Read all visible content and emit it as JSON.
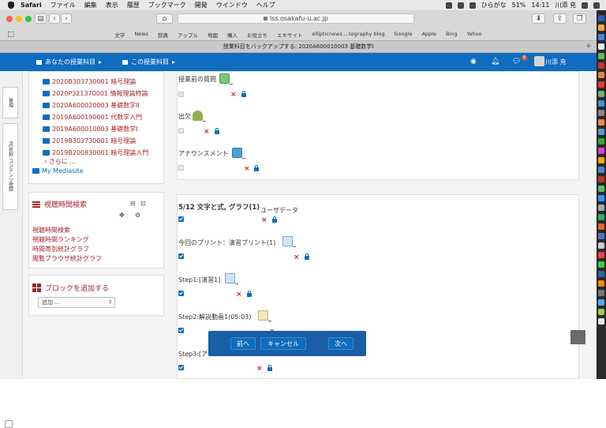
{
  "menubar": {
    "app": "Safari",
    "items": [
      "ファイル",
      "編集",
      "表示",
      "履歴",
      "ブックマーク",
      "開発",
      "ウインドウ",
      "ヘルプ"
    ],
    "input_method": "ひらがな",
    "battery": "51%",
    "time": "14:11",
    "user": "川添 充"
  },
  "browser": {
    "url": "lss.osakafu-u.ac.jp",
    "favorites": [
      "文学",
      "News",
      "辞典",
      "アップル",
      "地図",
      "購入",
      "お役立ち",
      "エキサイト",
      "ellipticnews ...tography blog",
      "Google",
      "Apple",
      "Bing",
      "Yahoo"
    ],
    "tab_title": "授業科目をバックアップする: 2020A600010003 基礎数学I"
  },
  "topnav": {
    "my_courses": "あなたの授業科目",
    "this_course": "この授業科目",
    "badge_count": "6",
    "username": "川添 充"
  },
  "drawer": {
    "tab1": "管理",
    "tab2": "PC名称 コンテンツ登録"
  },
  "sidebar": {
    "courses": [
      "2020B303730001 暗号理論",
      "2020P321370001 情報理論特論",
      "2020A600020003 基礎数学II",
      "2019A600190001 代数学入門",
      "2019A600010003 基礎数学I",
      "2019B303730001 暗号理論",
      "2019B200830001 暗号理論入門"
    ],
    "more": "さらに ...",
    "mediasite": "My Mediasite",
    "views_block": {
      "title": "視聴時間検索",
      "links": [
        "視聴時間検索",
        "視聴時間ランキング",
        "時間帯別統計グラフ",
        "閲覧ブラウザ統計グラフ"
      ]
    },
    "add_block": {
      "title": "ブロックを追加する",
      "select_value": "追加 ..."
    }
  },
  "main": {
    "section_a": [
      "授業前の質問",
      "出欠",
      "アナウンスメント"
    ],
    "section_b": {
      "title": "5/12 文字と式, グラフ(1)",
      "user_data": "ユーザデータ",
      "items": [
        "今回のプリント：演習プリント(1)",
        "Step1:[演習1]",
        "Step2:解説動画1(05:03)",
        "Step3:[ア"
      ]
    }
  },
  "bottom": {
    "prev": "前へ",
    "cancel": "キャンセル",
    "next": "次へ"
  }
}
